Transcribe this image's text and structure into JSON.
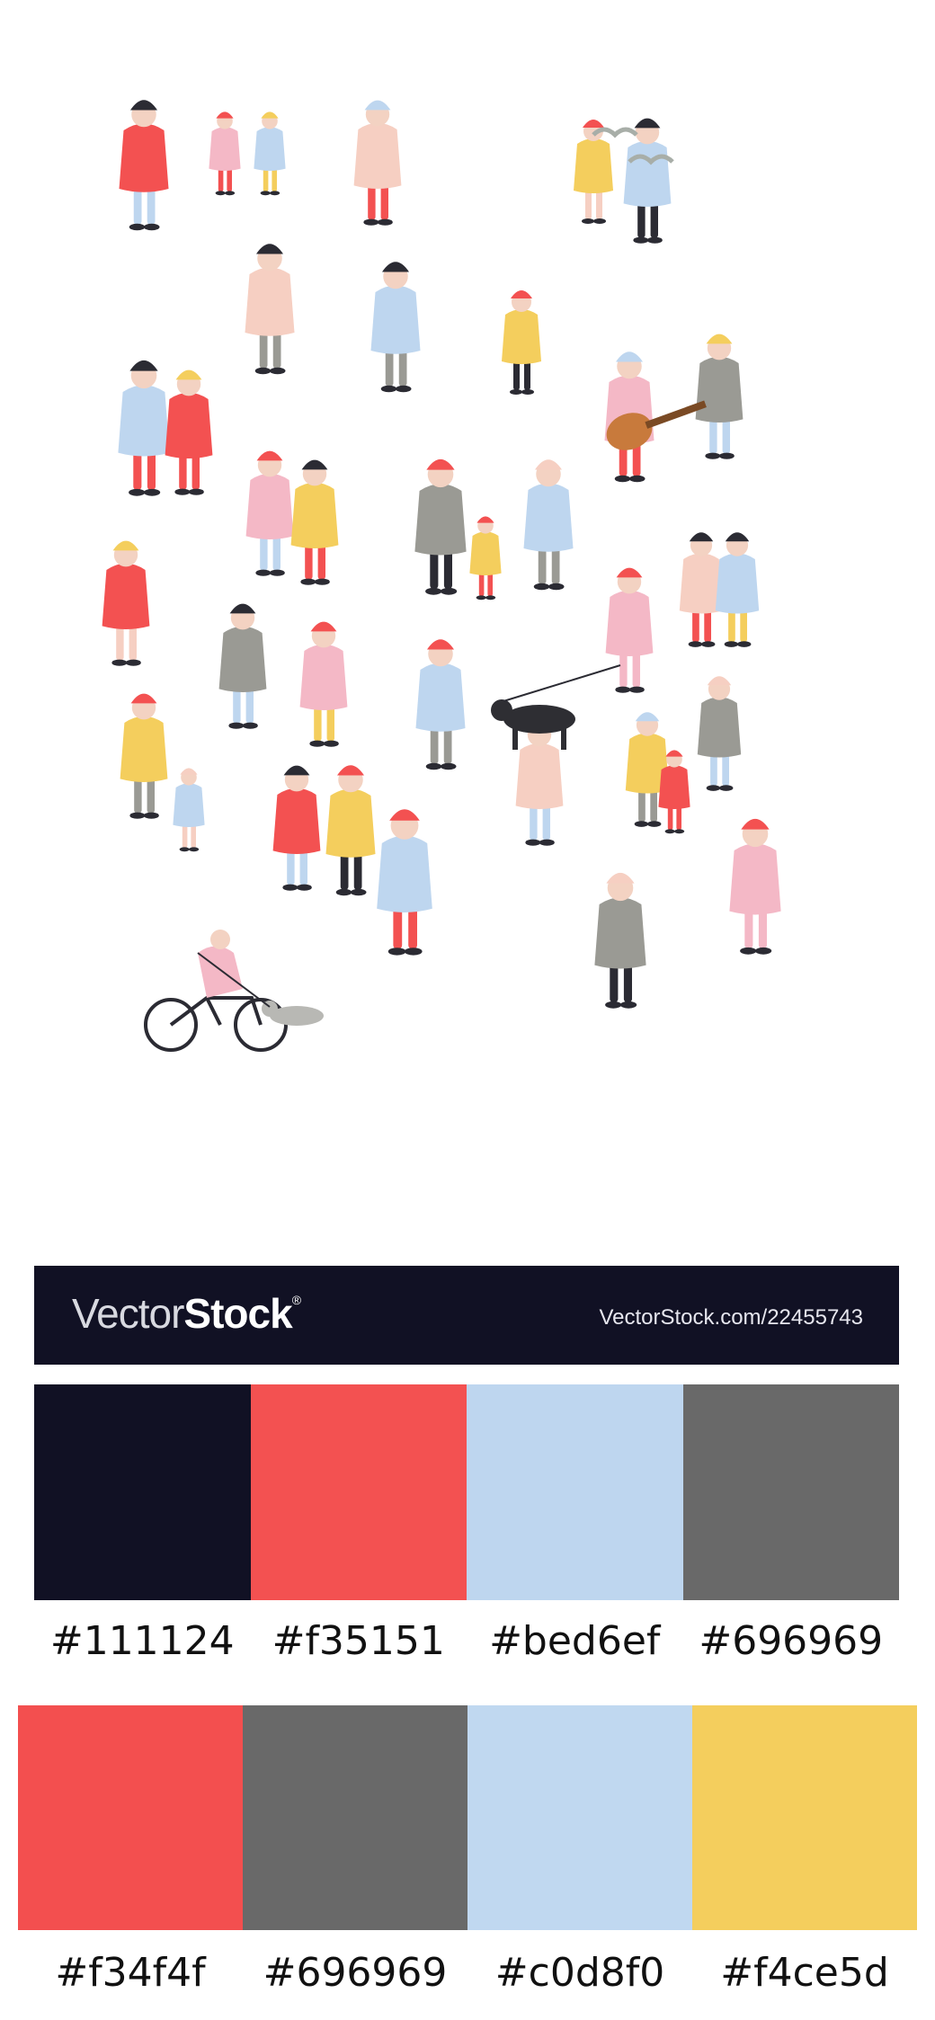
{
  "banner": {
    "brand_light": "Vector",
    "brand_bold": "Stock",
    "brand_mark": "®",
    "url": "VectorStock.com/22455743"
  },
  "palette_top": [
    {
      "hex": "#111124",
      "label": "#111124"
    },
    {
      "hex": "#f35151",
      "label": "#f35151"
    },
    {
      "hex": "#bed6ef",
      "label": "#bed6ef"
    },
    {
      "hex": "#696969",
      "label": "#696969"
    }
  ],
  "palette_bottom": [
    {
      "hex": "#f34f4f",
      "label": "#f34f4f"
    },
    {
      "hex": "#696969",
      "label": "#696969"
    },
    {
      "hex": "#c0d8f0",
      "label": "#c0d8f0"
    },
    {
      "hex": "#f4ce5d",
      "label": "#f4ce5d"
    }
  ],
  "illustration_colors": {
    "navy": "#111124",
    "red": "#f35151",
    "blue": "#bed6ef",
    "gray": "#9a9a94",
    "yellow": "#f4ce5d",
    "pink": "#f4b8c6",
    "peach": "#f6cfc2",
    "skin": "#f3d2c2",
    "dark": "#2b2b33",
    "black": "#2e2e33"
  }
}
